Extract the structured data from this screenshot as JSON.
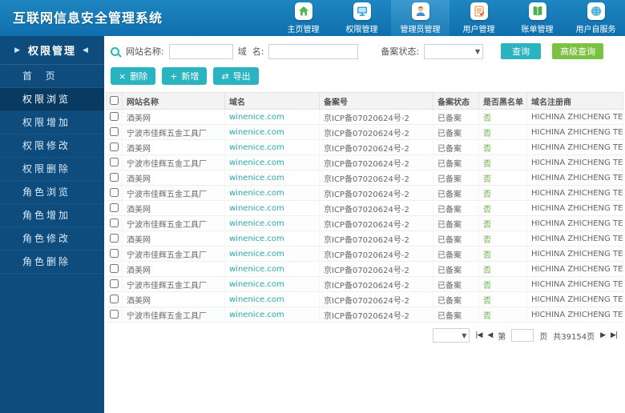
{
  "header": {
    "title": "互联网信息安全管理系统",
    "nav": [
      {
        "label": "主页管理",
        "icon": "home-icon",
        "active": false
      },
      {
        "label": "权限管理",
        "icon": "monitor-icon",
        "active": false
      },
      {
        "label": "管理员管理",
        "icon": "admin-icon",
        "active": true
      },
      {
        "label": "用户管理",
        "icon": "form-icon",
        "active": false
      },
      {
        "label": "账单管理",
        "icon": "ledger-icon",
        "active": false
      },
      {
        "label": "用户自服务",
        "icon": "globe-icon",
        "active": false
      }
    ]
  },
  "sidebar": {
    "title_prefix": "▶",
    "title": "权限管理",
    "title_suffix": "◀",
    "items": [
      {
        "label": "首  页",
        "active": false
      },
      {
        "label": "权限浏览",
        "active": true
      },
      {
        "label": "权限增加",
        "active": false
      },
      {
        "label": "权限修改",
        "active": false
      },
      {
        "label": "权限删除",
        "active": false
      },
      {
        "label": "角色浏览",
        "active": false
      },
      {
        "label": "角色增加",
        "active": false
      },
      {
        "label": "角色修改",
        "active": false
      },
      {
        "label": "角色删除",
        "active": false
      }
    ]
  },
  "search": {
    "site_name_label": "网站名称:",
    "site_name_value": "",
    "domain_label": "域  名:",
    "domain_value": "",
    "status_label": "备案状态:",
    "status_value": "",
    "query_button": "查询",
    "advanced_query_button": "高级查询"
  },
  "toolbar": {
    "delete_button": {
      "icon": "×",
      "label": "删除"
    },
    "add_button": {
      "icon": "+",
      "label": "新增"
    },
    "export_button": {
      "icon": "⇄",
      "label": "导出"
    }
  },
  "table": {
    "columns": [
      "网站名称",
      "域名",
      "备案号",
      "备案状态",
      "是否黑名单",
      "域名注册商"
    ],
    "rows": [
      {
        "site_name": "酒美网",
        "domain": "winenice.com",
        "icp_number": "京ICP备07020624号-2",
        "record_status": "已备案",
        "blacklist": "否",
        "registrar": "HICHINA ZHICHENG TECHNOLOGY"
      },
      {
        "site_name": "宁波市佳辉五金工具厂",
        "domain": "winenice.com",
        "icp_number": "京ICP备07020624号-2",
        "record_status": "已备案",
        "blacklist": "否",
        "registrar": "HICHINA ZHICHENG TECHNOLOGY"
      },
      {
        "site_name": "酒美网",
        "domain": "winenice.com",
        "icp_number": "京ICP备07020624号-2",
        "record_status": "已备案",
        "blacklist": "否",
        "registrar": "HICHINA ZHICHENG TECHNOLOGY"
      },
      {
        "site_name": "宁波市佳辉五金工具厂",
        "domain": "winenice.com",
        "icp_number": "京ICP备07020624号-2",
        "record_status": "已备案",
        "blacklist": "否",
        "registrar": "HICHINA ZHICHENG TECHNOLOGY"
      },
      {
        "site_name": "酒美网",
        "domain": "winenice.com",
        "icp_number": "京ICP备07020624号-2",
        "record_status": "已备案",
        "blacklist": "否",
        "registrar": "HICHINA ZHICHENG TECHNOLOGY"
      },
      {
        "site_name": "宁波市佳辉五金工具厂",
        "domain": "winenice.com",
        "icp_number": "京ICP备07020624号-2",
        "record_status": "已备案",
        "blacklist": "否",
        "registrar": "HICHINA ZHICHENG TECHNOLOGY"
      },
      {
        "site_name": "酒美网",
        "domain": "winenice.com",
        "icp_number": "京ICP备07020624号-2",
        "record_status": "已备案",
        "blacklist": "否",
        "registrar": "HICHINA ZHICHENG TECHNOLOGY"
      },
      {
        "site_name": "宁波市佳辉五金工具厂",
        "domain": "winenice.com",
        "icp_number": "京ICP备07020624号-2",
        "record_status": "已备案",
        "blacklist": "否",
        "registrar": "HICHINA ZHICHENG TECHNOLOGY"
      },
      {
        "site_name": "酒美网",
        "domain": "winenice.com",
        "icp_number": "京ICP备07020624号-2",
        "record_status": "已备案",
        "blacklist": "否",
        "registrar": "HICHINA ZHICHENG TECHNOLOGY"
      },
      {
        "site_name": "宁波市佳辉五金工具厂",
        "domain": "winenice.com",
        "icp_number": "京ICP备07020624号-2",
        "record_status": "已备案",
        "blacklist": "否",
        "registrar": "HICHINA ZHICHENG TECHNOLOGY"
      },
      {
        "site_name": "酒美网",
        "domain": "winenice.com",
        "icp_number": "京ICP备07020624号-2",
        "record_status": "已备案",
        "blacklist": "否",
        "registrar": "HICHINA ZHICHENG TECHNOLOGY"
      },
      {
        "site_name": "宁波市佳辉五金工具厂",
        "domain": "winenice.com",
        "icp_number": "京ICP备07020624号-2",
        "record_status": "已备案",
        "blacklist": "否",
        "registrar": "HICHINA ZHICHENG TECHNOLOGY"
      },
      {
        "site_name": "酒美网",
        "domain": "winenice.com",
        "icp_number": "京ICP备07020624号-2",
        "record_status": "已备案",
        "blacklist": "否",
        "registrar": "HICHINA ZHICHENG TECHNOLOGY"
      },
      {
        "site_name": "宁波市佳辉五金工具厂",
        "domain": "winenice.com",
        "icp_number": "京ICP备07020624号-2",
        "record_status": "已备案",
        "blacklist": "否",
        "registrar": "HICHINA ZHICHENG TECHNOLOGY"
      }
    ]
  },
  "pagination": {
    "select_value": "",
    "first_label": "|◀",
    "prev_label": "◀",
    "page_prefix": "第",
    "page_input_value": "",
    "page_suffix": "页",
    "total_pages_text": "共39154页",
    "next_label": "▶",
    "last_label": "▶|"
  },
  "colors": {
    "header_blue": "#1478b5",
    "sidebar_blue": "#0e4c7d",
    "teal": "#2ab4c0",
    "green_button": "#7bc142",
    "link_teal": "#2aa8b0",
    "blacklist_green": "#5fae2f"
  }
}
